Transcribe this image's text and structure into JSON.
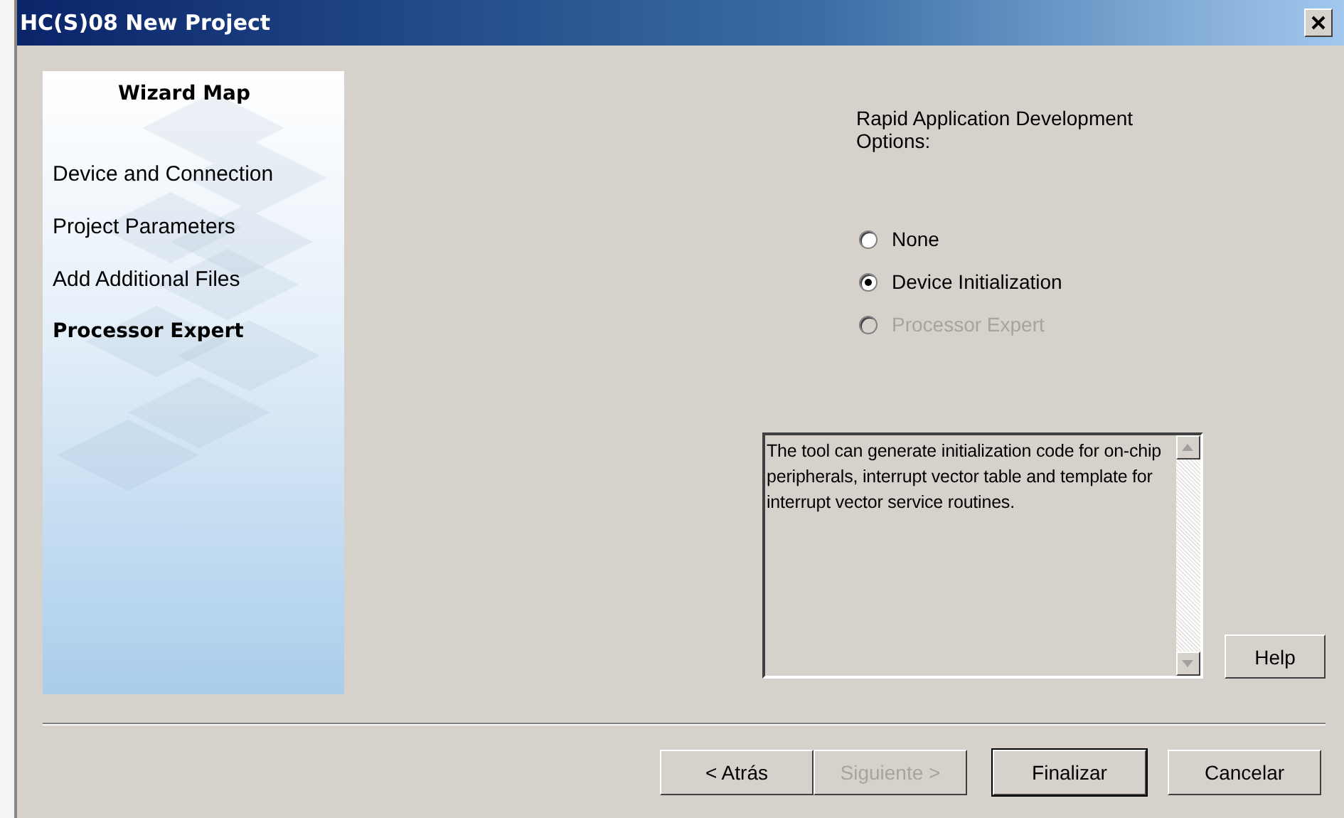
{
  "window": {
    "title": "HC(S)08 New Project"
  },
  "wizard_map": {
    "title": "Wizard Map",
    "items": [
      {
        "label": "Device and Connection",
        "selected": false
      },
      {
        "label": "Project Parameters",
        "selected": false
      },
      {
        "label": "Add Additional Files",
        "selected": false
      },
      {
        "label": "Processor Expert",
        "selected": true
      }
    ]
  },
  "options": {
    "label": "Rapid Application Development Options:",
    "radios": [
      {
        "label": "None",
        "selected": false,
        "disabled": false
      },
      {
        "label": "Device Initialization",
        "selected": true,
        "disabled": false
      },
      {
        "label": "Processor Expert",
        "selected": false,
        "disabled": true
      }
    ]
  },
  "description": "The tool can generate initialization code for on-chip peripherals, interrupt vector table and template for interrupt vector service routines.",
  "help_button": "Help",
  "buttons": [
    {
      "label": "< Atrás",
      "disabled": false,
      "default": false
    },
    {
      "label": "Siguiente >",
      "disabled": true,
      "default": false
    },
    {
      "label": "Finalizar",
      "disabled": false,
      "default": true
    },
    {
      "label": "Cancelar",
      "disabled": false,
      "default": false
    }
  ]
}
